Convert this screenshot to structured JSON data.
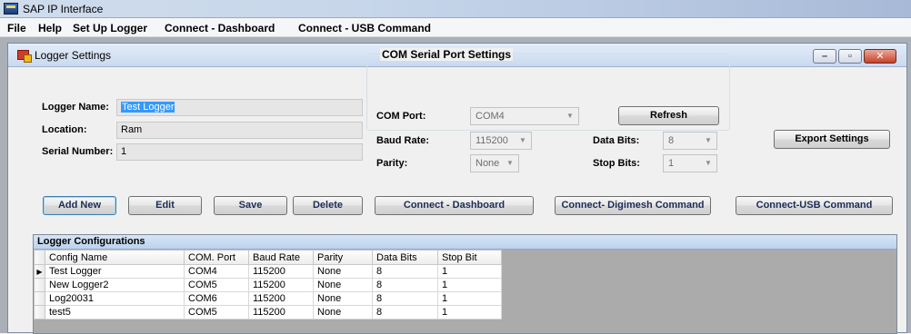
{
  "app": {
    "title": "SAP IP Interface"
  },
  "menu": [
    {
      "label": "File"
    },
    {
      "label": "Help"
    },
    {
      "label": "Set Up Logger"
    },
    {
      "label": "Connect - Dashboard"
    },
    {
      "label": "Connect - USB Command"
    }
  ],
  "child_window": {
    "title": "Logger Settings"
  },
  "logger": {
    "name_label": "Logger Name:",
    "name_value": "Test Logger",
    "location_label": "Location:",
    "location_value": "Ram",
    "serial_label": "Serial Number:",
    "serial_value": "1"
  },
  "com": {
    "group_label": "COM Serial Port Settings",
    "port_label": "COM Port:",
    "port_value": "COM4",
    "refresh_label": "Refresh",
    "baud_label": "Baud Rate:",
    "baud_value": "115200",
    "databits_label": "Data Bits:",
    "databits_value": "8",
    "parity_label": "Parity:",
    "parity_value": "None",
    "stopbits_label": "Stop Bits:",
    "stopbits_value": "1"
  },
  "buttons": {
    "export": "Export Settings",
    "add_new": "Add New",
    "edit": "Edit",
    "save": "Save",
    "delete": "Delete",
    "connect_dashboard": "Connect - Dashboard",
    "connect_digimesh": "Connect- Digimesh Command",
    "connect_usb": "Connect-USB Command"
  },
  "grid": {
    "caption": "Logger Configurations",
    "columns": [
      "Config Name",
      "COM. Port",
      "Baud Rate",
      "Parity",
      "Data Bits",
      "Stop Bit"
    ],
    "rows": [
      [
        "Test Logger",
        "COM4",
        "115200",
        "None",
        "8",
        "1"
      ],
      [
        "New Logger2",
        "COM5",
        "115200",
        "None",
        "8",
        "1"
      ],
      [
        "Log20031",
        "COM6",
        "115200",
        "None",
        "8",
        "1"
      ],
      [
        "test5",
        "COM5",
        "115200",
        "None",
        "8",
        "1"
      ]
    ],
    "selected_row": 0
  }
}
